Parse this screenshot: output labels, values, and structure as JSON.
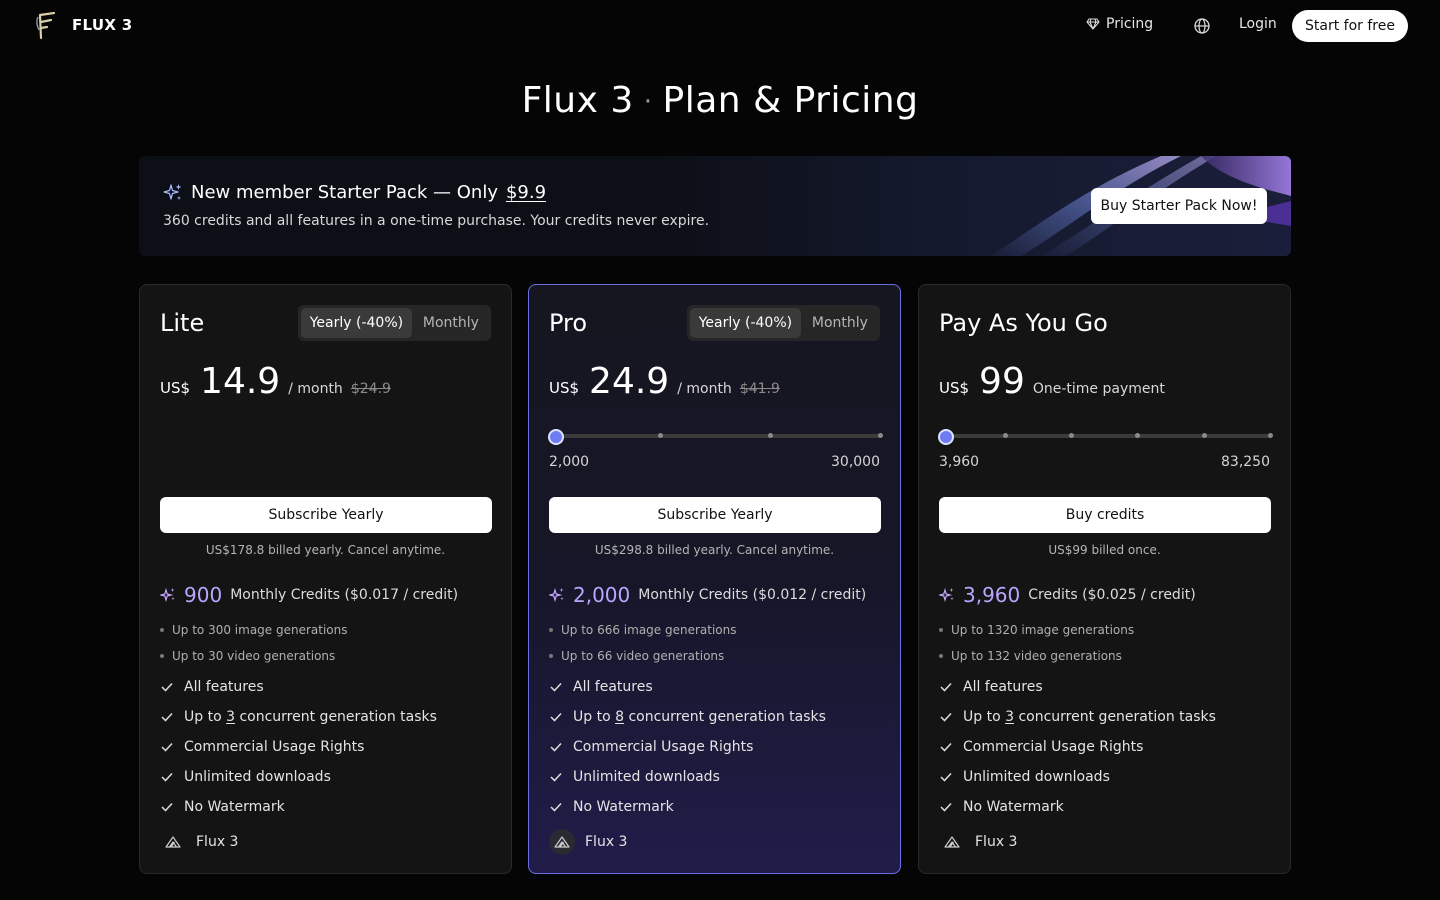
{
  "header": {
    "brand": "FLUX 3",
    "pricing_label": "Pricing",
    "login_label": "Login",
    "start_label": "Start for free"
  },
  "page_title": {
    "main": "Flux 3",
    "separator": "·",
    "sub": "Plan & Pricing"
  },
  "banner": {
    "headline": "New member Starter Pack — Only",
    "price": "$9.9",
    "subtext": "360 credits and all features in a one-time purchase. Your credits never expire.",
    "button_label": "Buy Starter Pack Now!"
  },
  "plans": [
    {
      "name": "Lite",
      "toggle": {
        "yearly": "Yearly (-40%)",
        "monthly": "Monthly",
        "selected": "yearly"
      },
      "currency": "US$",
      "price": "14.9",
      "period": "/ month",
      "old_price": "$24.9",
      "cta": "Subscribe Yearly",
      "billing": "US$178.8 billed yearly. Cancel anytime.",
      "credits": "900",
      "credits_desc": "Monthly Credits ($0.017 / credit)",
      "sub_items": [
        "Up to 300 image generations",
        "Up to 30 video generations"
      ],
      "features": {
        "f1": "All features",
        "f2_pre": "Up to",
        "f2_num": "3",
        "f2_post": "concurrent generation tasks",
        "f3": "Commercial Usage Rights",
        "f4": "Unlimited downloads",
        "f5": "No Watermark"
      },
      "model": "Flux 3"
    },
    {
      "name": "Pro",
      "toggle": {
        "yearly": "Yearly (-40%)",
        "monthly": "Monthly",
        "selected": "yearly"
      },
      "currency": "US$",
      "price": "24.9",
      "period": "/ month",
      "old_price": "$41.9",
      "slider": {
        "min_label": "2,000",
        "max_label": "30,000",
        "value": "2,000"
      },
      "cta": "Subscribe Yearly",
      "billing": "US$298.8 billed yearly. Cancel anytime.",
      "credits": "2,000",
      "credits_desc": "Monthly Credits ($0.012 / credit)",
      "sub_items": [
        "Up to 666 image generations",
        "Up to 66 video generations"
      ],
      "features": {
        "f1": "All features",
        "f2_pre": "Up to",
        "f2_num": "8",
        "f2_post": "concurrent generation tasks",
        "f3": "Commercial Usage Rights",
        "f4": "Unlimited downloads",
        "f5": "No Watermark"
      },
      "model": "Flux 3"
    },
    {
      "name": "Pay As You Go",
      "currency": "US$",
      "price": "99",
      "period": "One-time payment",
      "slider": {
        "min_label": "3,960",
        "max_label": "83,250",
        "value": "3,960"
      },
      "cta": "Buy credits",
      "billing": "US$99 billed once.",
      "credits": "3,960",
      "credits_desc": "Credits ($0.025 / credit)",
      "sub_items": [
        "Up to 1320 image generations",
        "Up to 132 video generations"
      ],
      "features": {
        "f1": "All features",
        "f2_pre": "Up to",
        "f2_num": "3",
        "f2_post": "concurrent generation tasks",
        "f3": "Commercial Usage Rights",
        "f4": "Unlimited downloads",
        "f5": "No Watermark"
      },
      "model": "Flux 3"
    }
  ],
  "colors": {
    "accent": "#6f7bf0",
    "credit_number": "#b9a6ff",
    "pro_border": "#6c6fe0"
  }
}
